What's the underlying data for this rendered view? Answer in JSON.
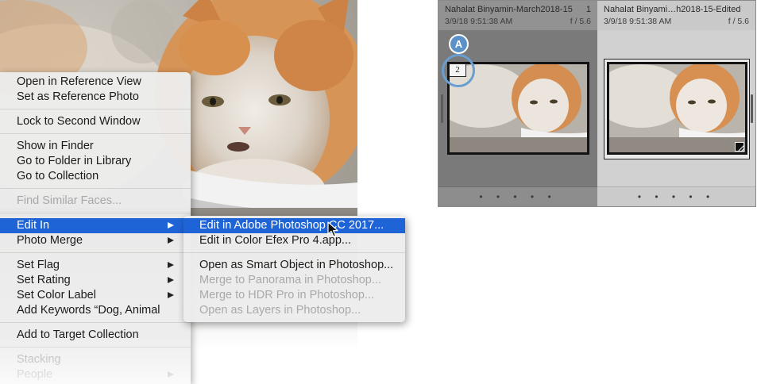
{
  "context_menu": {
    "items": [
      {
        "label": "Open in Reference View",
        "disabled": false,
        "submenu": false
      },
      {
        "label": "Set as Reference Photo",
        "disabled": false,
        "submenu": false
      },
      {
        "label": "Lock to Second Window",
        "disabled": false,
        "submenu": false
      },
      {
        "label": "Show in Finder",
        "disabled": false,
        "submenu": false
      },
      {
        "label": "Go to Folder in Library",
        "disabled": false,
        "submenu": false
      },
      {
        "label": "Go to Collection",
        "disabled": false,
        "submenu": false
      },
      {
        "label": "Find Similar Faces...",
        "disabled": true,
        "submenu": false
      },
      {
        "label": "Edit In",
        "disabled": false,
        "submenu": true,
        "highlighted": true
      },
      {
        "label": "Photo Merge",
        "disabled": false,
        "submenu": true
      },
      {
        "label": "Set Flag",
        "disabled": false,
        "submenu": true
      },
      {
        "label": "Set Rating",
        "disabled": false,
        "submenu": true
      },
      {
        "label": "Set Color Label",
        "disabled": false,
        "submenu": true
      },
      {
        "label": "Add Keywords “Dog, Animal",
        "disabled": false,
        "submenu": false
      },
      {
        "label": "Add to Target Collection",
        "disabled": false,
        "submenu": false
      },
      {
        "label": "Stacking",
        "disabled": true,
        "submenu": false
      },
      {
        "label": "People",
        "disabled": true,
        "submenu": true
      }
    ]
  },
  "edit_in_submenu": {
    "items": [
      {
        "label": "Edit in Adobe Photoshop CC 2017...",
        "highlighted": true,
        "disabled": false
      },
      {
        "label": "Edit in Color Efex Pro 4.app...",
        "disabled": false
      },
      {
        "label": "Open as Smart Object in Photoshop...",
        "disabled": false
      },
      {
        "label": "Merge to Panorama in Photoshop...",
        "disabled": true
      },
      {
        "label": "Merge to HDR Pro in Photoshop...",
        "disabled": true
      },
      {
        "label": "Open as Layers in Photoshop...",
        "disabled": true
      }
    ]
  },
  "filmstrip": {
    "cells": [
      {
        "filename": "Nahalat Binyamin-March2018-15",
        "index": "1",
        "date": "3/9/18 9:51:38 AM",
        "fstop": "f / 5.6",
        "stack_count": "2",
        "dots": "• • • • •"
      },
      {
        "filename": "Nahalat Binyami…h2018-15-Edited",
        "index": "",
        "date": "3/9/18 9:51:38 AM",
        "fstop": "f / 5.6",
        "dots": "• • • • •"
      }
    ],
    "callout_label": "A"
  },
  "colors": {
    "highlight": "#1f64d6",
    "callout": "#5a92c8"
  },
  "icons": {
    "cursor": "arrow-cursor-icon",
    "submenu_arrow": "chevron-right-icon",
    "edited_badge": "edited-badge-icon"
  }
}
